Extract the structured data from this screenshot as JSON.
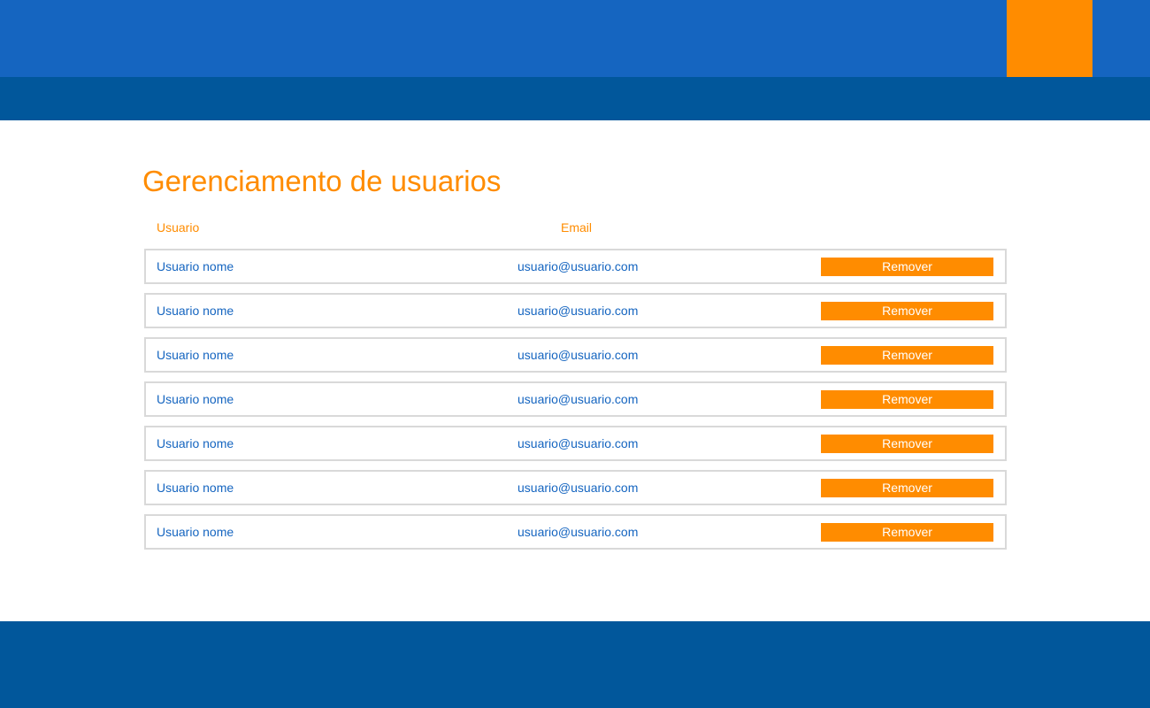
{
  "colors": {
    "primary_blue": "#1565c0",
    "dark_blue": "#01579b",
    "accent_orange": "#ff8c00",
    "row_border": "#d9d9d9"
  },
  "page": {
    "title": "Gerenciamento de usuarios"
  },
  "table": {
    "columns": {
      "user": "Usuario",
      "email": "Email"
    },
    "rows": [
      {
        "name": "Usuario nome",
        "email": "usuario@usuario.com",
        "action": "Remover"
      },
      {
        "name": "Usuario nome",
        "email": "usuario@usuario.com",
        "action": "Remover"
      },
      {
        "name": "Usuario nome",
        "email": "usuario@usuario.com",
        "action": "Remover"
      },
      {
        "name": "Usuario nome",
        "email": "usuario@usuario.com",
        "action": "Remover"
      },
      {
        "name": "Usuario nome",
        "email": "usuario@usuario.com",
        "action": "Remover"
      },
      {
        "name": "Usuario nome",
        "email": "usuario@usuario.com",
        "action": "Remover"
      },
      {
        "name": "Usuario nome",
        "email": "usuario@usuario.com",
        "action": "Remover"
      }
    ]
  }
}
